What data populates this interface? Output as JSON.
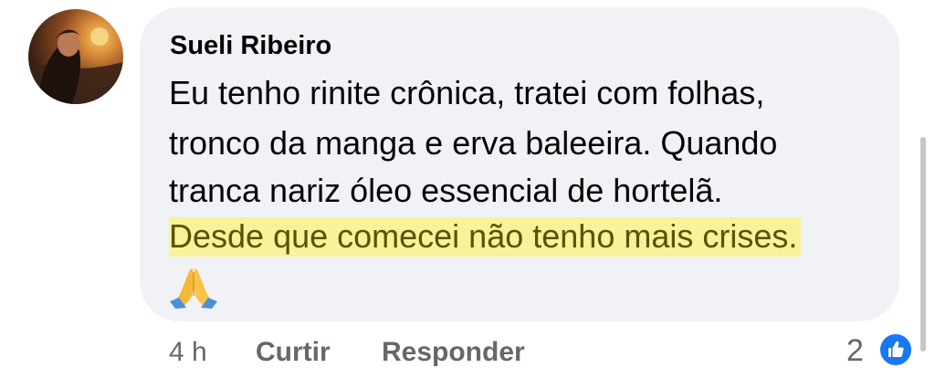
{
  "comment": {
    "author": "Sueli Ribeiro",
    "lines": [
      "Eu tenho rinite crônica,  tratei com folhas,",
      "tronco da manga e erva baleeira.  Quando",
      "tranca nariz óleo essencial de hortelã."
    ],
    "highlighted_line": "Desde que comecei não tenho mais crises",
    "highlighted_line_end": ".",
    "emoji_icon": "folded-hands-icon",
    "highlight_color": "#f6f39a"
  },
  "footer": {
    "time": "4 h",
    "like_label": "Curtir",
    "reply_label": "Responder",
    "reaction_count": "2",
    "reaction_icon": "thumbs-up-icon",
    "reaction_color": "#1877f2"
  }
}
